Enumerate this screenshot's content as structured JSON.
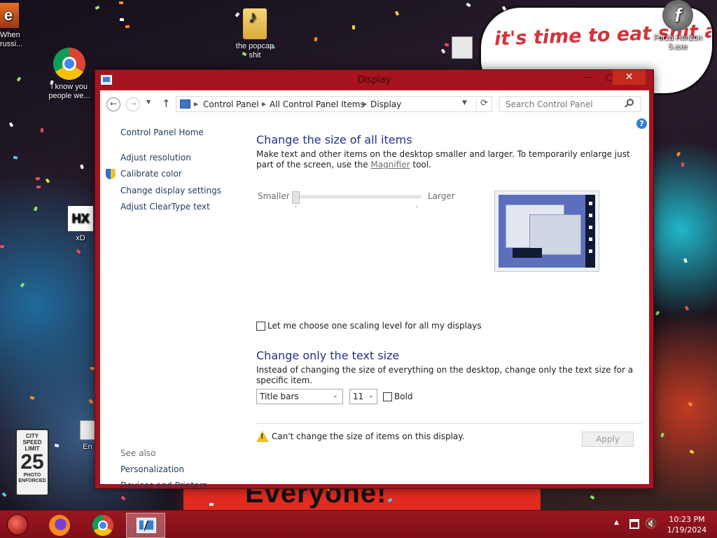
{
  "desktop": {
    "speech_bubble_text": "it's time to eat shit and die andcelebrate",
    "banner_text": "Everyone!",
    "sign_text": {
      "top": "CITY SPEED LIMIT",
      "number": "25",
      "bottom": "PHOTO ENFORCED"
    },
    "icons": [
      {
        "name": "when-russi-shortcut",
        "label": "When\nrussi...",
        "glyph": "e-icon"
      },
      {
        "name": "chrome-shortcut",
        "label": "i know you\npeople we...",
        "glyph": "chrome-icon"
      },
      {
        "name": "popcap-folder",
        "label": "the popcap\nshit",
        "glyph": "folder-icon"
      },
      {
        "name": "forza-horizon-shortcut",
        "label": "Forza Horizon\n5.exe",
        "glyph": "flash-icon"
      },
      {
        "name": "xd-shortcut",
        "label": "xD",
        "glyph": "hx-icon"
      },
      {
        "name": "en-shortcut",
        "label": "En",
        "glyph": "file-icon"
      }
    ]
  },
  "window": {
    "title": "Display",
    "controls": {
      "minimize": "—",
      "maximize": "□",
      "close": "✕"
    },
    "nav": {
      "back": "←",
      "forward": "→",
      "recent": "▼",
      "up": "↑"
    },
    "breadcrumb": [
      "Control Panel",
      "All Control Panel Items",
      "Display"
    ],
    "breadcrumb_sep": "▶",
    "address_dropdown": "▼",
    "refresh": "⟳",
    "search_placeholder": "Search Control Panel",
    "help": "?"
  },
  "left_pane": {
    "home": "Control Panel Home",
    "links": [
      "Adjust resolution",
      "Calibrate color",
      "Change display settings",
      "Adjust ClearType text"
    ],
    "see_also_label": "See also",
    "see_also": [
      "Personalization",
      "Devices and Printers"
    ]
  },
  "main": {
    "size_heading": "Change the size of all items",
    "size_desc_before": "Make text and other items on the desktop smaller and larger. To temporarily enlarge just part of the screen, use the ",
    "magnifier_link": "Magnifier",
    "size_desc_after": " tool.",
    "slider_min_label": "Smaller",
    "slider_max_label": "Larger",
    "slider_value": 0,
    "scaling_checkbox_label": "Let me choose one scaling level for all my displays",
    "scaling_checked": false,
    "text_heading": "Change only the text size",
    "text_desc": "Instead of changing the size of everything on the desktop, change only the text size for a specific item.",
    "item_select": "Title bars",
    "size_select": "11",
    "bold_label": "Bold",
    "bold_checked": false,
    "warning_text": "Can't change the size of items on this display.",
    "apply_label": "Apply"
  },
  "taskbar": {
    "apps": [
      {
        "name": "firefox",
        "active": false
      },
      {
        "name": "chrome",
        "active": false
      },
      {
        "name": "control-panel",
        "active": true
      }
    ],
    "tray_arrow": "▲",
    "volume": "🔇",
    "time": "10:23 PM",
    "date": "1/19/2024"
  },
  "colors": {
    "window_frame": "#a6141f",
    "heading_blue": "#1e3287",
    "link_blue": "#1e395b",
    "close_red": "#c42b1c",
    "taskbar": "#8b1219"
  }
}
